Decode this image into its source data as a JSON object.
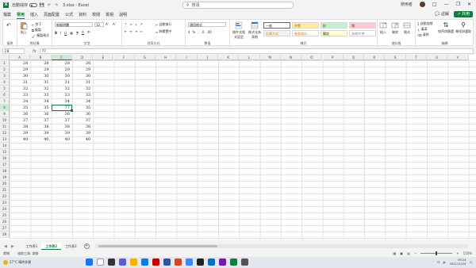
{
  "window": {
    "app_letter": "X",
    "autosave_label": "自動儲存",
    "doc_title": "3.xlsx - Excel",
    "search_placeholder": "搜尋",
    "user_name": "使用者"
  },
  "tabs": [
    "檔案",
    "常用",
    "插入",
    "頁面配置",
    "公式",
    "資料",
    "校閱",
    "檢視",
    "說明"
  ],
  "active_tab": "常用",
  "comment_label": "註解",
  "share_label": "共用",
  "ribbon": {
    "undo_label": "復原",
    "clipboard": {
      "paste": "貼上",
      "cut": "剪下",
      "copy": "複製",
      "format_painter": "複製格式",
      "label": "剪貼簿"
    },
    "font": {
      "name": "新細明體",
      "size": "12",
      "label": "字型"
    },
    "alignment": {
      "wrap": "自動換行",
      "merge": "跨欄置中",
      "label": "對齊方式"
    },
    "number": {
      "format": "通用格式",
      "label": "數值"
    },
    "styles": {
      "conditional": "條件式格式設定",
      "as_table": "格式化為表格",
      "normal": "一般",
      "neutral": "中等",
      "good": "好",
      "bad": "壞",
      "calc": "計算方式",
      "check": "檢查儲存...",
      "note": "備註",
      "explanatory": "說明文字",
      "label": "樣式"
    },
    "cells": {
      "insert": "插入",
      "delete": "刪除",
      "format": "格式",
      "label": "儲存格"
    },
    "editing": {
      "autosum": "自動加總",
      "fill": "填滿",
      "clear": "清除",
      "sort": "排序與篩選",
      "find": "尋找與選取",
      "label": "編輯"
    }
  },
  "formula_bar": {
    "name_box": "C8",
    "fx": "fx",
    "content": "77"
  },
  "columns": [
    "A",
    "B",
    "C",
    "D",
    "E",
    "F",
    "G",
    "H",
    "I",
    "J",
    "K",
    "L",
    "M",
    "N",
    "O",
    "P",
    "Q",
    "R",
    "S",
    "T",
    "U",
    "V"
  ],
  "selected_column": "C",
  "rows": [
    "1",
    "2",
    "3",
    "4",
    "5",
    "6",
    "7",
    "8",
    "9",
    "10",
    "11",
    "12",
    "13",
    "14",
    "15",
    "16",
    "17",
    "18",
    "19",
    "20",
    "21",
    "22",
    "23",
    "24",
    "25",
    "26",
    "27",
    "28"
  ],
  "selected_row": "8",
  "cells": {
    "A": [
      "28",
      "29",
      "30",
      "31",
      "32",
      "33",
      "34",
      "35",
      "36",
      "37",
      "38",
      "39",
      "40"
    ],
    "B": [
      "28",
      "29",
      "30",
      "31",
      "32",
      "33",
      "34",
      "35",
      "36",
      "37",
      "38",
      "39",
      "40"
    ],
    "C": [
      "28",
      "29",
      "30",
      "31",
      "32",
      "33",
      "34",
      "77",
      "36",
      "37",
      "38",
      "39",
      "40"
    ],
    "D": [
      "28",
      "29",
      "30",
      "31",
      "32",
      "33",
      "34",
      "35",
      "36",
      "37",
      "38",
      "39",
      "40"
    ]
  },
  "sheets": [
    "工作表1",
    "工作表2",
    "工作表3"
  ],
  "active_sheet": "工作表2",
  "status": {
    "ready": "就緒",
    "accessibility": "協助工具: 調查",
    "zoom": "110%"
  },
  "taskbar": {
    "temperature": "27°C",
    "weather_text": "晴時多雲",
    "search_label": "搜尋",
    "time": "09:24",
    "date": "2021/10/24"
  },
  "colors": {
    "accent": "#107c41"
  }
}
